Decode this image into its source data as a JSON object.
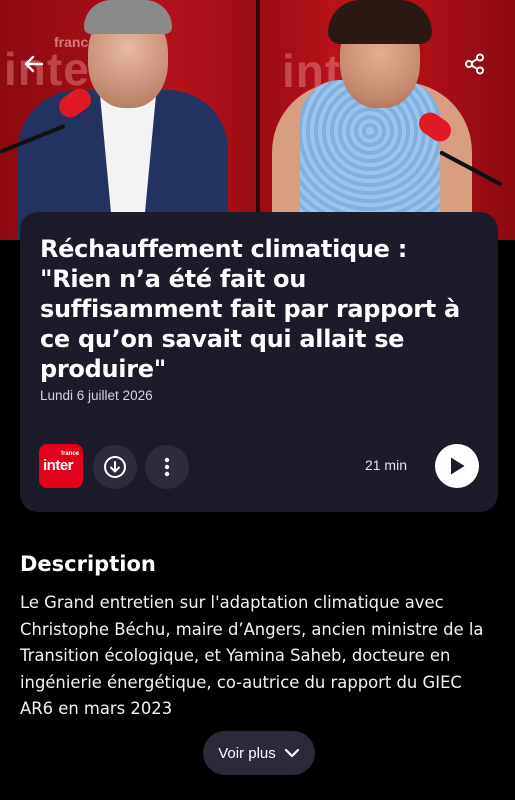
{
  "hero": {
    "back_icon": "arrow-left-icon",
    "share_icon": "share-icon",
    "wall_text_left": "inter",
    "wall_small_left": "france",
    "wall_text_right": "inter"
  },
  "episode": {
    "title": "Réchauffement climatique : \"Rien n’a été fait ou suffisamment fait par rapport à ce qu’on savait qui allait se produire\"",
    "date": "Lundi 6 juillet 2026",
    "logo_top": "france",
    "logo_main": "inter",
    "duration": "21 min",
    "download_icon": "download-icon",
    "more_icon": "more-vertical-icon",
    "play_icon": "play-icon"
  },
  "description": {
    "heading": "Description",
    "text": "Le Grand entretien sur l'adaptation climatique avec Christophe Béchu, maire d’Angers, ancien ministre de la Transition écologique, et Yamina Saheb, docteure en ingénierie énergétique, co-autrice du rapport du GIEC AR6 en mars 2023",
    "more_label": "Voir plus",
    "more_icon": "chevron-down-icon"
  },
  "colors": {
    "card_bg": "#1c1b2a",
    "brand_red": "#e3001b",
    "button_bg": "#2d2c3c"
  }
}
